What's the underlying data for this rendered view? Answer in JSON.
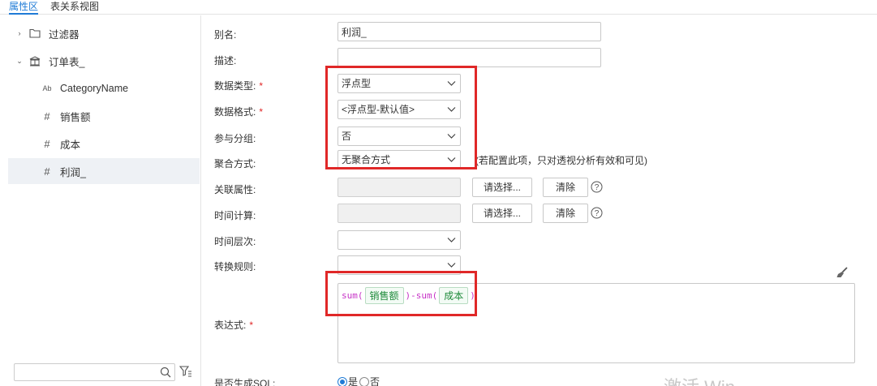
{
  "tabs": {
    "properties": "属性区",
    "relations": "表关系视图"
  },
  "tree": {
    "filter": "过滤器",
    "table": "订单表_",
    "fields": [
      {
        "type_icon": "Ab",
        "label": "CategoryName"
      },
      {
        "type_icon": "#",
        "label": "销售额"
      },
      {
        "type_icon": "#",
        "label": "成本"
      },
      {
        "type_icon": "#",
        "label": "利润_"
      }
    ]
  },
  "form": {
    "alias_label": "别名:",
    "alias_value": "利润_",
    "description_label": "描述:",
    "description_value": "",
    "data_type_label": "数据类型:",
    "data_type_value": "浮点型",
    "data_format_label": "数据格式:",
    "data_format_value": "<浮点型-默认值>",
    "grouping_label": "参与分组:",
    "grouping_value": "否",
    "aggregation_label": "聚合方式:",
    "aggregation_value": "无聚合方式",
    "aggregation_hint": "(若配置此项，只对透视分析有效和可见)",
    "related_attr_label": "关联属性:",
    "time_calc_label": "时间计算:",
    "time_level_label": "时间层次:",
    "transform_label": "转换规则:",
    "expression_label": "表达式:",
    "generate_sql_label": "是否生成SQL:",
    "choose_button": "请选择...",
    "clear_button": "清除",
    "required_mark": "*",
    "help_mark": "?"
  },
  "expression": {
    "fn_open": "sum(",
    "field_1": "销售额",
    "middle": ")-sum(",
    "field_2": "成本",
    "close": ")"
  },
  "sql_radio": {
    "yes": "是",
    "no": "否",
    "selected": "是"
  },
  "watermark": "激活 Win",
  "colors": {
    "accent": "#1f7bd6",
    "highlight_box": "#e02828",
    "expr_function": "#c632c6",
    "expr_field": "#1e8a3a"
  }
}
